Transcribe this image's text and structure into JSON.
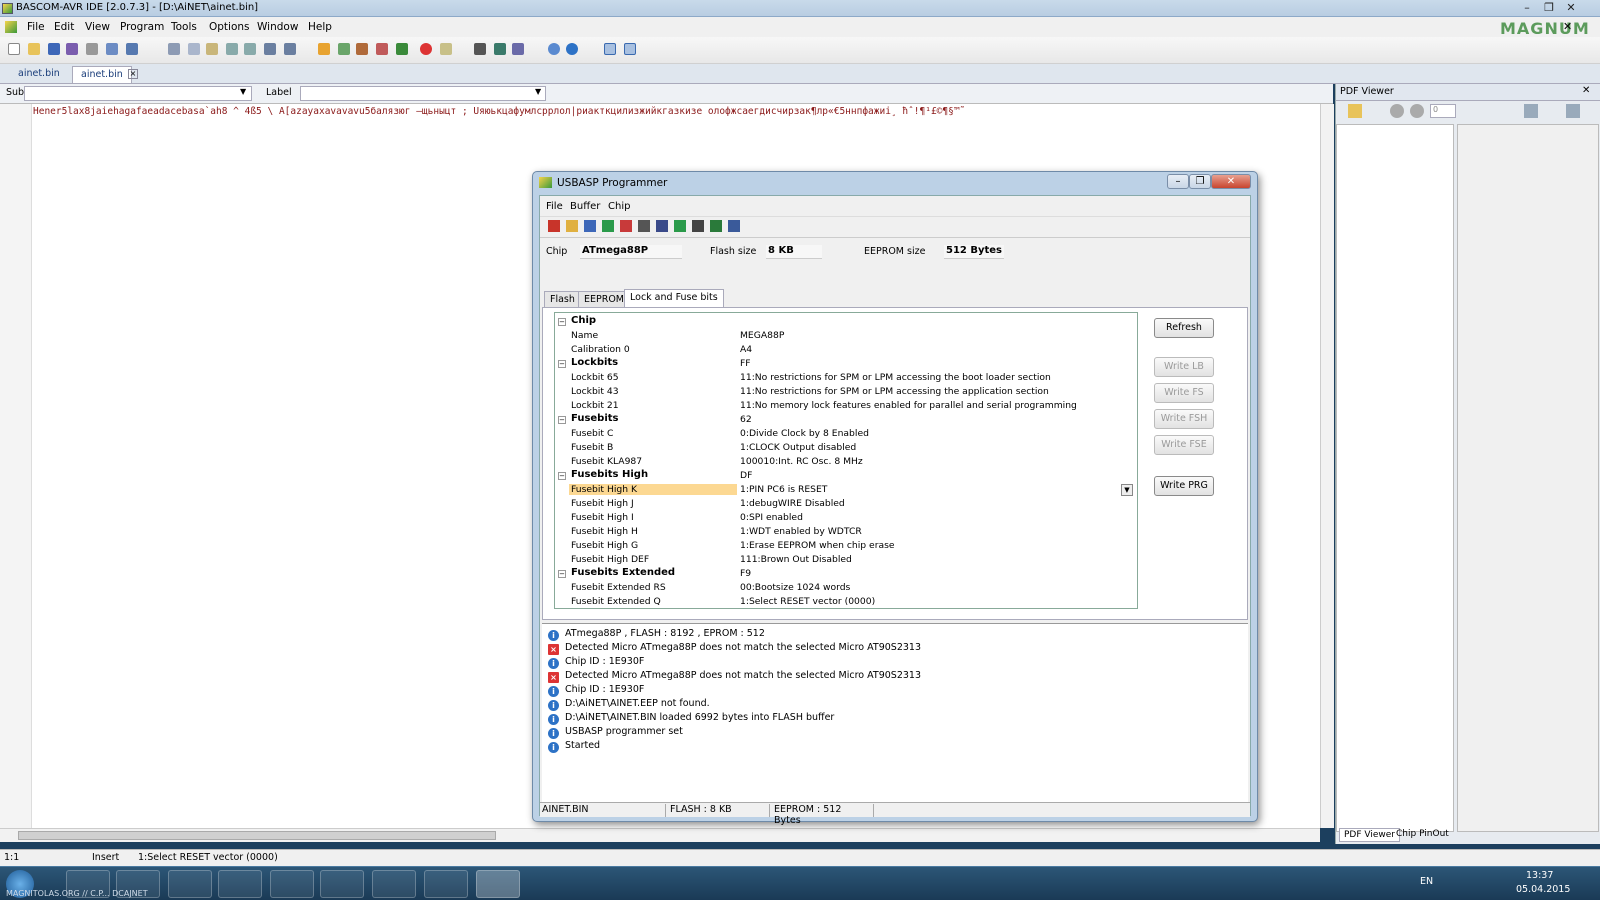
{
  "window": {
    "title": "BASCOM-AVR IDE [2.0.7.3] - [D:\\AiNET\\ainet.bin]"
  },
  "menu": [
    "File",
    "Edit",
    "View",
    "Program",
    "Tools",
    "Options",
    "Window",
    "Help"
  ],
  "doc_tabs": [
    "ainet.bin",
    "ainet.bin"
  ],
  "subbar": {
    "sub_label": "Sub",
    "label_label": "Label"
  },
  "editor": {
    "code": "Hener5lax8jaiehagafaeadacebasa`ah8 ^ 4ß5 \\ A[azayaxavavavu5балязюг —щьныцт ; Üяюькцафумлсррлол|риакткцилизжийкгазкизе олофжсаегдисчирзак¶лр«€5ннпфажиі¸ ħˆ!¶¹£©¶§™˜"
  },
  "pdf": {
    "title": "PDF Viewer",
    "tab1": "PDF Viewer",
    "tab2": "Chip PinOut",
    "page": "0",
    "logo": "MAGNUM"
  },
  "status": {
    "pos": "1:1",
    "mode": "Insert",
    "msg": "1:Select RESET vector (0000)"
  },
  "taskbar": {
    "lang": "EN",
    "time": "13:37",
    "date": "05.04.2015",
    "label": "MAGNITOLAS.ORG // C.P... DCAJNET"
  },
  "dialog": {
    "title": "USBASP Programmer",
    "menu": [
      "File",
      "Buffer",
      "Chip"
    ],
    "chip_label": "Chip",
    "chip": "ATmega88P",
    "flash_label": "Flash size",
    "flash": "8 KB",
    "eeprom_label": "EEPROM size",
    "eeprom": "512 Bytes",
    "tabs": [
      "Flash",
      "EEPROM",
      "Lock and Fuse bits"
    ],
    "rows": [
      {
        "k": "Chip",
        "v": "",
        "h": true
      },
      {
        "k": "Name",
        "v": "MEGA88P"
      },
      {
        "k": "Calibration 0",
        "v": "A4"
      },
      {
        "k": "Lockbits",
        "v": "FF",
        "h": true
      },
      {
        "k": "Lockbit 65",
        "v": "11:No restrictions for SPM or LPM accessing the boot loader section"
      },
      {
        "k": "Lockbit 43",
        "v": "11:No restrictions for SPM or LPM accessing the application section"
      },
      {
        "k": "Lockbit 21",
        "v": "11:No memory lock features enabled for parallel and serial programming"
      },
      {
        "k": "Fusebits",
        "v": "62",
        "h": true
      },
      {
        "k": "Fusebit C",
        "v": "0:Divide Clock by 8 Enabled"
      },
      {
        "k": "Fusebit B",
        "v": "1:CLOCK Output disabled"
      },
      {
        "k": "Fusebit KLA987",
        "v": "100010:Int. RC Osc. 8 MHz"
      },
      {
        "k": "Fusebits High",
        "v": "DF",
        "h": true
      },
      {
        "k": "Fusebit High K",
        "v": "1:PIN PC6 is RESET",
        "sel": true
      },
      {
        "k": "Fusebit High J",
        "v": "1:debugWIRE Disabled"
      },
      {
        "k": "Fusebit High I",
        "v": "0:SPI enabled"
      },
      {
        "k": "Fusebit High H",
        "v": "1:WDT enabled by WDTCR"
      },
      {
        "k": "Fusebit High G",
        "v": "1:Erase EEPROM when chip erase"
      },
      {
        "k": "Fusebit High DEF",
        "v": "111:Brown Out Disabled"
      },
      {
        "k": "Fusebits Extended",
        "v": "F9",
        "h": true
      },
      {
        "k": "Fusebit Extended RS",
        "v": "00:Bootsize 1024 words"
      },
      {
        "k": "Fusebit Extended Q",
        "v": "1:Select RESET vector (0000)"
      }
    ],
    "buttons": [
      "Refresh",
      "Write LB",
      "Write FS",
      "Write FSH",
      "Write FSE",
      "Write PRG"
    ],
    "log": [
      {
        "t": "info",
        "m": "ATmega88P , FLASH : 8192 , EPROM : 512"
      },
      {
        "t": "err",
        "m": "Detected Micro ATmega88P does not match the selected Micro AT90S2313"
      },
      {
        "t": "info",
        "m": "Chip ID : 1E930F"
      },
      {
        "t": "err",
        "m": "Detected Micro ATmega88P does not match the selected Micro AT90S2313"
      },
      {
        "t": "info",
        "m": "Chip ID : 1E930F"
      },
      {
        "t": "info",
        "m": "D:\\AiNET\\AINET.EEP not found."
      },
      {
        "t": "info",
        "m": "D:\\AiNET\\AINET.BIN loaded 6992 bytes into FLASH buffer"
      },
      {
        "t": "info",
        "m": "USBASP programmer set"
      },
      {
        "t": "info",
        "m": "Started"
      }
    ],
    "status": [
      "AINET.BIN",
      "FLASH : 8 KB",
      "EEPROM : 512 Bytes"
    ]
  }
}
